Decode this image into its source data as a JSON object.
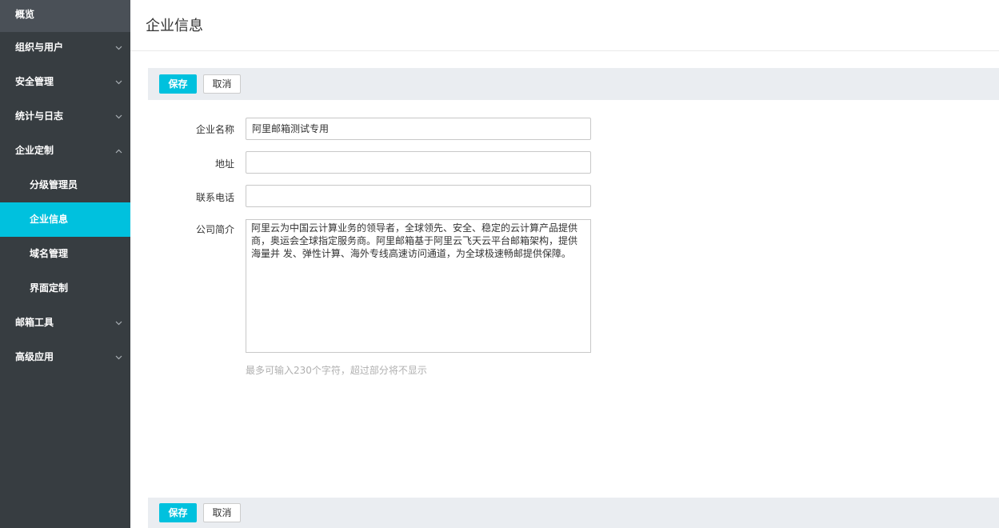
{
  "sidebar": {
    "items": [
      {
        "label": "概览",
        "expandable": false
      },
      {
        "label": "组织与用户",
        "expandable": true,
        "expanded": false
      },
      {
        "label": "安全管理",
        "expandable": true,
        "expanded": false
      },
      {
        "label": "统计与日志",
        "expandable": true,
        "expanded": false
      },
      {
        "label": "企业定制",
        "expandable": true,
        "expanded": true
      },
      {
        "label": "分级管理员",
        "sub": true
      },
      {
        "label": "企业信息",
        "sub": true,
        "active": true
      },
      {
        "label": "域名管理",
        "sub": true
      },
      {
        "label": "界面定制",
        "sub": true
      },
      {
        "label": "邮箱工具",
        "expandable": true,
        "expanded": false
      },
      {
        "label": "高级应用",
        "expandable": true,
        "expanded": false
      }
    ]
  },
  "main": {
    "title": "企业信息",
    "toolbar": {
      "save_label": "保存",
      "cancel_label": "取消"
    },
    "form": {
      "company_name": {
        "label": "企业名称",
        "value": "阿里邮箱测试专用"
      },
      "address": {
        "label": "地址",
        "value": ""
      },
      "phone": {
        "label": "联系电话",
        "value": ""
      },
      "intro": {
        "label": "公司简介",
        "value": "阿里云为中国云计算业务的领导者，全球领先、安全、稳定的云计算产品提供商，奥运会全球指定服务商。阿里邮箱基于阿里云飞天云平台邮箱架构，提供海量并 发、弹性计算、海外专线高速访问通道，为全球极速畅邮提供保障。"
      },
      "hint": "最多可输入230个字符，超过部分将不显示"
    }
  },
  "colors": {
    "sidebar_bg": "#373d41",
    "accent": "#00c1de",
    "toolbar_bg": "#eaedf1"
  },
  "icons": {
    "chevron_down": "chevron-down-icon",
    "chevron_up": "chevron-up-icon"
  }
}
